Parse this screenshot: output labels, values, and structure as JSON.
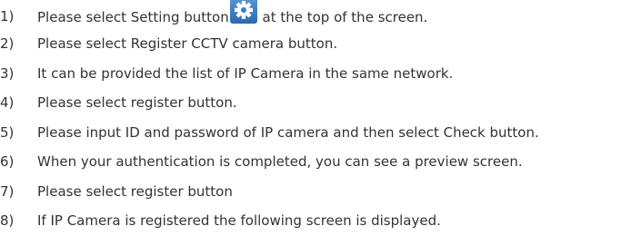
{
  "steps": [
    {
      "number": "1)",
      "before": "Please select Setting button",
      "icon": "gear-icon",
      "after": " at the top of the screen."
    },
    {
      "number": "2)",
      "text": "Please select Register CCTV camera button."
    },
    {
      "number": "3)",
      "text": "It can be provided the list of IP Camera in the same network."
    },
    {
      "number": "4)",
      "text": "Please select register button."
    },
    {
      "number": "5)",
      "text": "Please input ID and password of IP camera and then select Check button."
    },
    {
      "number": "6)",
      "text": "When your authentication is completed, you can see a preview screen."
    },
    {
      "number": "7)",
      "text": "Please select register button"
    },
    {
      "number": "8)",
      "text": "If IP Camera is registered the following screen is displayed."
    }
  ],
  "colors": {
    "text": "#333333",
    "icon_background": "#3a7fc1",
    "icon_gear": "#ffffff"
  }
}
